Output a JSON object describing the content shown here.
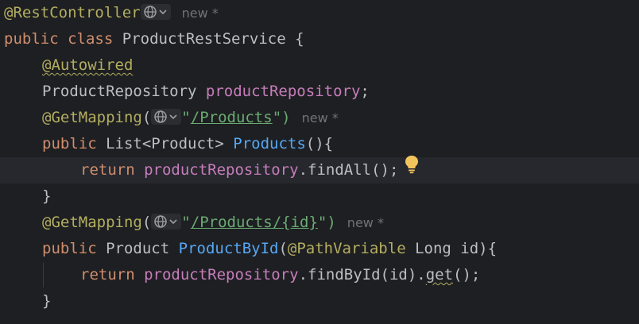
{
  "code": {
    "line1": {
      "annotation": "@RestController",
      "hint": "new *"
    },
    "line2": {
      "kw_public": "public",
      "kw_class": "class",
      "class_name": "ProductRestService",
      "brace": "{"
    },
    "line3": {
      "annotation": "@Autowired"
    },
    "line4": {
      "type": "ProductRepository",
      "field": "productRepository",
      "semicolon": ";"
    },
    "line5": {
      "annotation": "@GetMapping",
      "paren_open": "(",
      "quote_open": "\"",
      "path": "/Products",
      "quote_close_paren": "\")",
      "hint": "new *"
    },
    "line6": {
      "kw_public": "public",
      "type": "List<Product>",
      "method": "Products",
      "tail": "(){"
    },
    "line7": {
      "kw_return": "return",
      "field": "productRepository",
      "call": ".findAll();"
    },
    "line8": {
      "brace": "}"
    },
    "line9": {
      "annotation": "@GetMapping",
      "paren_open": "(",
      "quote_open": "\"",
      "path_prefix": "/Products/",
      "path_var": "{id}",
      "quote_close_paren": "\")",
      "hint": "new *"
    },
    "line10": {
      "kw_public": "public",
      "type": "Product",
      "method": "ProductById",
      "paren_open": "(",
      "param_annotation": "@PathVariable",
      "param": "Long id",
      "tail": "){"
    },
    "line11": {
      "kw_return": "return",
      "field": "productRepository",
      "call_a": ".findById(id).",
      "call_get": "get",
      "call_b": "();"
    },
    "line12": {
      "brace": "}"
    }
  },
  "icons": {
    "globe": "globe-icon",
    "chevron": "chevron-down-icon",
    "bulb": "lightbulb-icon"
  },
  "colors": {
    "background": "#1e1f22",
    "current_line": "#26282e",
    "keyword": "#cf8e6d",
    "annotation": "#b3ae60",
    "method": "#56a8f5",
    "field": "#c77dbb",
    "string": "#6aab73",
    "text": "#bcbec4",
    "hint": "#6f737a",
    "bulb": "#f2c55c"
  }
}
